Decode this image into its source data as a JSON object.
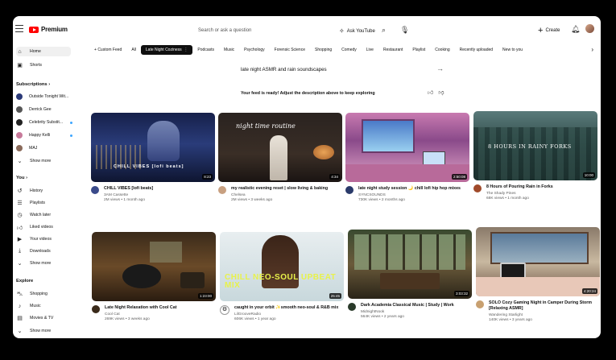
{
  "header": {
    "logo_text": "Premium",
    "search_placeholder": "Search or ask a question",
    "ask_label": "Ask YouTube",
    "create_label": "Create"
  },
  "sidebar": {
    "home": "Home",
    "shorts": "Shorts",
    "subscriptions_heading": "Subscriptions",
    "subscriptions": [
      "Outside Tonight Wit...",
      "Derrick Gee",
      "Celebrity Substit...",
      "Happy Kelli",
      "MAJ"
    ],
    "show_more_1": "Show more",
    "you_heading": "You",
    "you_items": [
      "History",
      "Playlists",
      "Watch later",
      "Liked videos",
      "Your videos",
      "Downloads"
    ],
    "show_more_2": "Show more",
    "explore_heading": "Explore",
    "explore_items": [
      "Shopping",
      "Music",
      "Movies & TV"
    ],
    "show_more_3": "Show more"
  },
  "chips": [
    "Custom Feed",
    "All",
    "Late Night Coziness",
    "Podcasts",
    "Music",
    "Psychology",
    "Forensic Science",
    "Shopping",
    "Comedy",
    "Live",
    "Restaurant",
    "Playlist",
    "Cooking",
    "Recently uploaded",
    "New to you"
  ],
  "prompt": {
    "text": "late night ASMR and rain soundscapes",
    "ready": "Your feed is ready! Adjust the description above to keep exploring"
  },
  "videos": [
    {
      "title": "CHILL VIBES [lofi beats]",
      "channel": "3AM Cassette",
      "stats": "2M views • 1 month ago",
      "duration": "8:23",
      "thumb_text": "CHILL VIBES [lofi beats]"
    },
    {
      "title": "my realistic evening reset | slow living & baking",
      "channel": "Chelsea",
      "stats": "2M views • 3 weeks ago",
      "duration": "4:34",
      "thumb_text": "night time routine"
    },
    {
      "title": "late night study session 🌙 chill lofi hip hop mixes",
      "channel": "SYNCSOUNDS",
      "stats": "730K views • 2 months ago",
      "duration": "2:50:08",
      "thumb_text": ""
    },
    {
      "title": "8 Hours of Pouring Rain in Forks",
      "channel": "The Shady Pines",
      "stats": "68K views • 1 month ago",
      "duration": "10:00",
      "thumb_text": "8 HOURS IN RAINY FORKS"
    },
    {
      "title": "Late Night Relaxation with Cool Cat",
      "channel": "Cool Cat",
      "stats": "269K views • 3 weeks ago",
      "duration": "1:23:00",
      "thumb_text": ""
    },
    {
      "title": "caught in your orbit ✨smooth neo-soul & R&B mix",
      "channel": "LilGrooveRadio",
      "stats": "606K views • 1 year ago",
      "duration": "25:45",
      "thumb_text": "CHILL NEO-SOUL UPBEAT MIX"
    },
    {
      "title": "Dark Academia Classical Music | Study | Work",
      "channel": "MidnightNook",
      "stats": "564K views • 2 years ago",
      "duration": "3:03:32",
      "thumb_text": ""
    },
    {
      "title": "SOLO Cozy Gaming Night in Camper During Storm [Relaxing ASMR]",
      "channel": "Wandering Starlight",
      "stats": "140K views • 3 years ago",
      "duration": "4:20:24",
      "thumb_text": ""
    }
  ]
}
